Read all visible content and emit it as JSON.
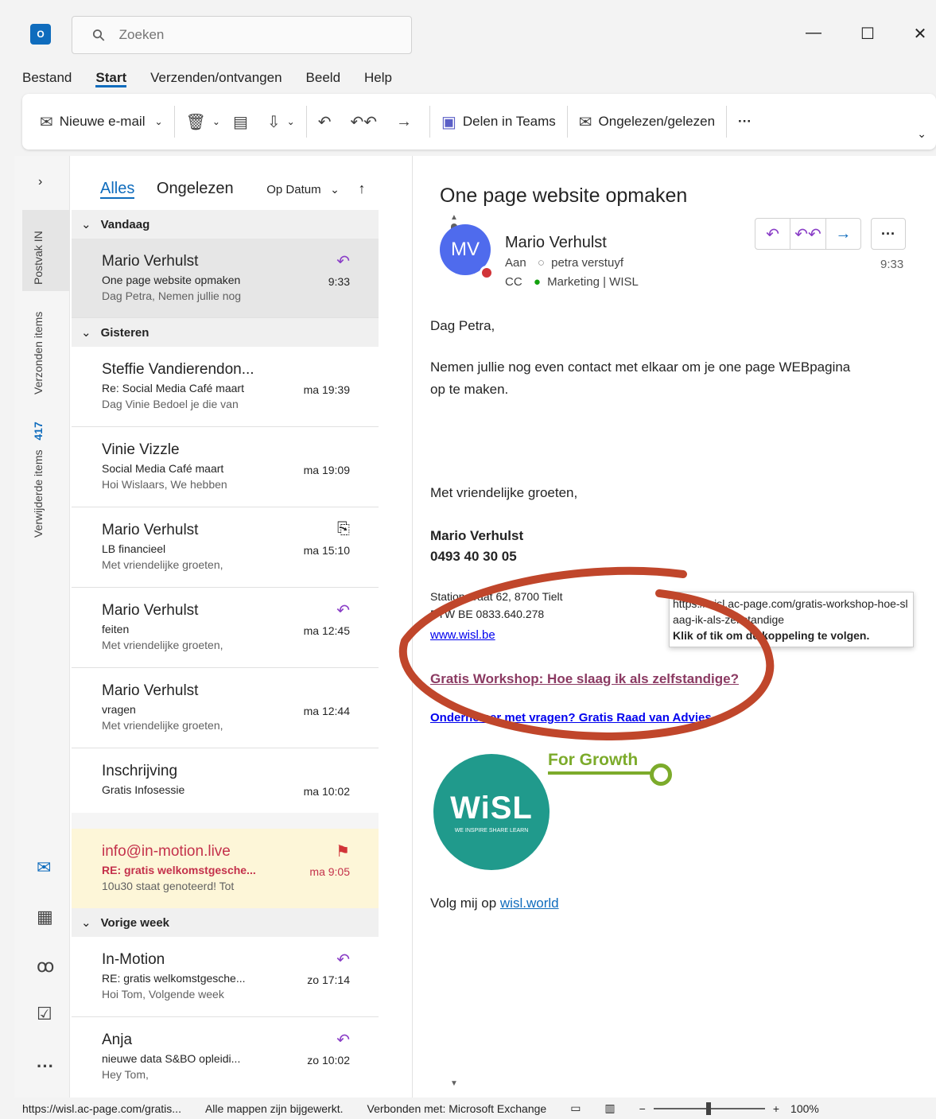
{
  "window": {
    "app_icon": "O",
    "search_placeholder": "Zoeken",
    "minimize": "—",
    "maximize": "☐",
    "close": "✕"
  },
  "menu": [
    "Bestand",
    "Start",
    "Verzenden/ontvangen",
    "Beeld",
    "Help"
  ],
  "ribbon": {
    "new_mail": "Nieuwe e-mail",
    "share_teams": "Delen in Teams",
    "read_unread": "Ongelezen/gelezen",
    "more": "···"
  },
  "folders": {
    "inbox": "Postvak IN",
    "sent": "Verzonden items",
    "deleted": "Verwijderde items",
    "deleted_count": "417"
  },
  "list": {
    "tab_all": "Alles",
    "tab_unread": "Ongelezen",
    "sort": "Op Datum",
    "groups": {
      "today": "Vandaag",
      "yesterday": "Gisteren",
      "lastweek": "Vorige week"
    },
    "items": [
      {
        "from": "Mario Verhulst",
        "subject": "One page website opmaken",
        "preview": "Dag Petra,  Nemen jullie nog",
        "time": "9:33"
      },
      {
        "from": "Steffie Vandierendon...",
        "subject": "Re: Social Media Café maart",
        "preview": "Dag Vinie  Bedoel je die van",
        "time": "ma 19:39"
      },
      {
        "from": "Vinie Vizzle",
        "subject": "Social Media Café maart",
        "preview": "Hoi Wislaars,  We hebben",
        "time": "ma 19:09"
      },
      {
        "from": "Mario Verhulst",
        "subject": "LB financieel",
        "preview": "Met vriendelijke groeten,",
        "time": "ma 15:10"
      },
      {
        "from": "Mario Verhulst",
        "subject": "feiten",
        "preview": "Met vriendelijke groeten,",
        "time": "ma 12:45"
      },
      {
        "from": "Mario Verhulst",
        "subject": "vragen",
        "preview": "Met vriendelijke groeten,",
        "time": "ma 12:44"
      },
      {
        "from": "Inschrijving",
        "subject": "Gratis Infosessie",
        "preview": "",
        "time": "ma 10:02"
      },
      {
        "from": "info@in-motion.live",
        "subject": "RE: gratis welkomstgesche...",
        "preview": "10u30 staat genoteerd!  Tot",
        "time": "ma 9:05"
      },
      {
        "from": "In-Motion",
        "subject": "RE: gratis welkomstgesche...",
        "preview": "Hoi Tom,  Volgende week",
        "time": "zo 17:14"
      },
      {
        "from": "Anja",
        "subject": "nieuwe data S&BO opleidi...",
        "preview": "Hey Tom,",
        "time": "zo 10:02"
      }
    ]
  },
  "message": {
    "subject": "One page website opmaken",
    "initials": "MV",
    "sender": "Mario Verhulst",
    "to_label": "Aan",
    "to": "petra verstuyf",
    "cc_label": "CC",
    "cc": "Marketing | WISL",
    "time": "9:33",
    "greeting": "Dag Petra,",
    "body1": "Nemen jullie nog even contact met elkaar om je one page WEBpagina",
    "body2": "op te maken.",
    "closing": "Met vriendelijke groeten,",
    "sig_name": "Mario Verhulst",
    "sig_phone": "0493 40 30 05",
    "address": "Stationstraat 62, 8700 Tielt",
    "btw": "BTW BE 0833.640.278",
    "website": "www.wisl.be",
    "link1": "Gratis Workshop: Hoe slaag ik als zelfstandige?",
    "link2": "Ondernemer met vragen? Gratis Raad van Advies",
    "logo_tag": "For Growth",
    "logo_text": "WiSL",
    "logo_sub": "WE INSPIRE SHARE LEARN",
    "follow": "Volg mij op",
    "follow_link": "wisl.world"
  },
  "tooltip": {
    "url": "https://wisl.ac-page.com/gratis-workshop-hoe-slaag-ik-als-zelfstandige",
    "hint": "Klik of tik om de koppeling te volgen."
  },
  "status": {
    "url": "https://wisl.ac-page.com/gratis...",
    "sync": "Alle mappen zijn bijgewerkt.",
    "connection": "Verbonden met: Microsoft Exchange",
    "zoom": "100%"
  },
  "colors": {
    "accent": "#0f6cbd",
    "reply": "#8a3ec7",
    "flag": "#d13438",
    "annotation": "#c0462b",
    "link_visited": "#8b3a62",
    "highlight_row": "#fdf6d8"
  }
}
